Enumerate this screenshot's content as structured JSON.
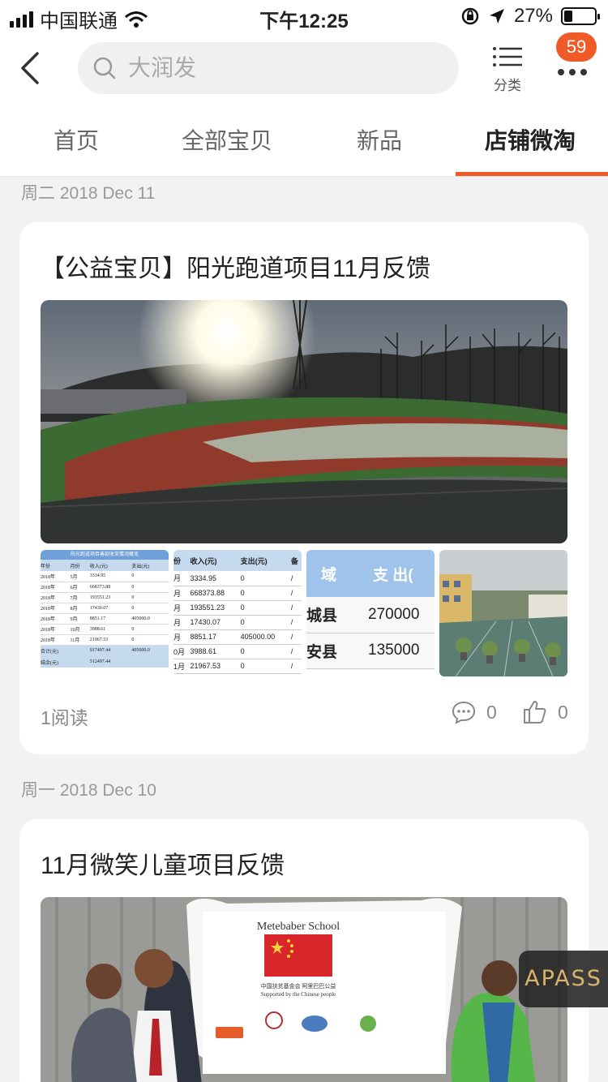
{
  "status_bar": {
    "carrier": "中国联通",
    "time": "下午12:25",
    "battery_percent": "27%",
    "battery_level": 0.27
  },
  "header": {
    "search_placeholder": "大润发",
    "category_label": "分类",
    "badge_count": "59"
  },
  "tabs": [
    {
      "label": "首页",
      "active": false
    },
    {
      "label": "全部宝贝",
      "active": false
    },
    {
      "label": "新品",
      "active": false
    },
    {
      "label": "店铺微淘",
      "active": true
    }
  ],
  "posts": [
    {
      "date": "周二 2018 Dec 11",
      "title": "【公益宝贝】阳光跑道项目11月反馈",
      "reads": "1阅读",
      "comments": "0",
      "likes": "0",
      "table1": {
        "title": "阳光跑道项目善款收支情况概览",
        "headers": [
          "年份",
          "月份",
          "收入(元)",
          "支出(元)"
        ],
        "rows": [
          [
            "2018年",
            "5月",
            "3334.95",
            "0"
          ],
          [
            "2018年",
            "6月",
            "668373.88",
            "0"
          ],
          [
            "2018年",
            "7月",
            "193551.23",
            "0"
          ],
          [
            "2018年",
            "8月",
            "17430.07",
            "0"
          ],
          [
            "2018年",
            "9月",
            "8851.17",
            "405000.0"
          ],
          [
            "2018年",
            "10月",
            "3988.61",
            "0"
          ],
          [
            "2018年",
            "11月",
            "21967.53",
            "0"
          ]
        ],
        "total_label": "合计(元)",
        "total_income": "917497.44",
        "total_expense": "405000.0",
        "balance_label": "结余(元)",
        "balance": "512497.44"
      },
      "table2": {
        "headers": [
          "份",
          "收入(元)",
          "支出(元)",
          "备"
        ],
        "rows": [
          [
            "月",
            "3334.95",
            "0",
            "/"
          ],
          [
            "月",
            "668373.88",
            "0",
            "/"
          ],
          [
            "月",
            "193551.23",
            "0",
            "/"
          ],
          [
            "月",
            "17430.07",
            "0",
            "/"
          ],
          [
            "月",
            "8851.17",
            "405000.00",
            "/"
          ],
          [
            "0月",
            "3988.61",
            "0",
            "/"
          ],
          [
            "1月",
            "21967.53",
            "0",
            "/"
          ]
        ]
      },
      "table3": {
        "headers": [
          "域",
          "支 出("
        ],
        "rows": [
          [
            "城县",
            "270000"
          ],
          [
            "安县",
            "135000"
          ]
        ]
      }
    },
    {
      "date": "周一 2018 Dec 10",
      "title": "11月微笑儿童项目反馈",
      "banner_school": "Metebaber School",
      "banner_line1": "中国扶贫基金会  阿里巴巴公益",
      "banner_line2": "Supported by the Chinese people"
    }
  ],
  "floating_badge": "APASS",
  "colors": {
    "accent": "#f05a26",
    "background": "#f2f2f2",
    "table_header_blue": "#c5d9ef"
  }
}
